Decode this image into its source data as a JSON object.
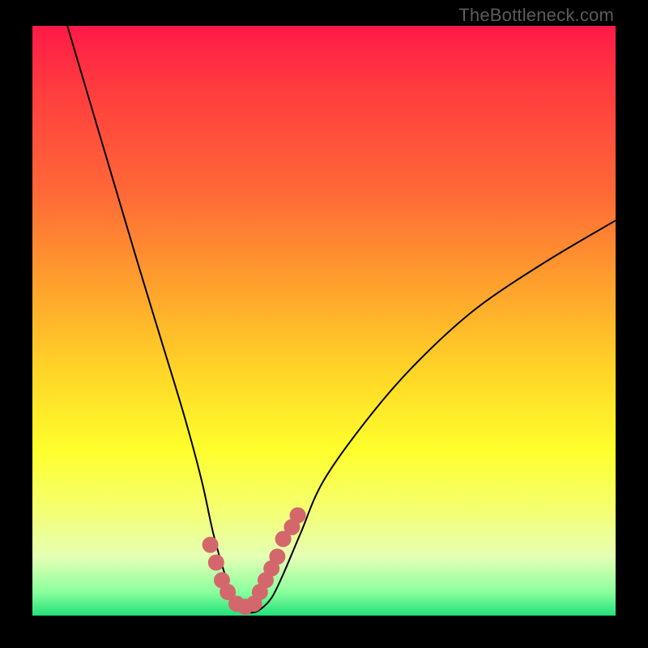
{
  "watermark": "TheBottleneck.com",
  "chart_data": {
    "type": "line",
    "title": "",
    "xlabel": "",
    "ylabel": "",
    "xlim": [
      0,
      100
    ],
    "ylim": [
      0,
      100
    ],
    "series": [
      {
        "name": "bottleneck-curve",
        "x": [
          6,
          12,
          18,
          22,
          26,
          29,
          31,
          33,
          34.5,
          36,
          37.5,
          39,
          41,
          43,
          46,
          50,
          58,
          66,
          76,
          88,
          100
        ],
        "values": [
          100,
          80,
          60,
          47,
          34,
          23,
          14,
          7,
          3,
          1,
          0.5,
          1,
          3,
          7,
          14,
          23,
          34,
          43,
          52,
          60,
          67
        ]
      }
    ],
    "markers": {
      "name": "bottleneck-zone-dots",
      "color": "#d4676c",
      "x": [
        30.5,
        31.5,
        32.5,
        33.5,
        35,
        36.5,
        38,
        39,
        40,
        41,
        42,
        43,
        44.5,
        45.5
      ],
      "values": [
        12,
        9,
        6,
        4,
        2,
        1.5,
        2,
        4,
        6,
        8,
        10,
        13,
        15,
        17
      ]
    },
    "gradient_stops": [
      {
        "pos": 0,
        "color": "#ff1a48"
      },
      {
        "pos": 28,
        "color": "#ff6837"
      },
      {
        "pos": 58,
        "color": "#ffd327"
      },
      {
        "pos": 82,
        "color": "#f5ff70"
      },
      {
        "pos": 100,
        "color": "#22e07a"
      }
    ]
  }
}
